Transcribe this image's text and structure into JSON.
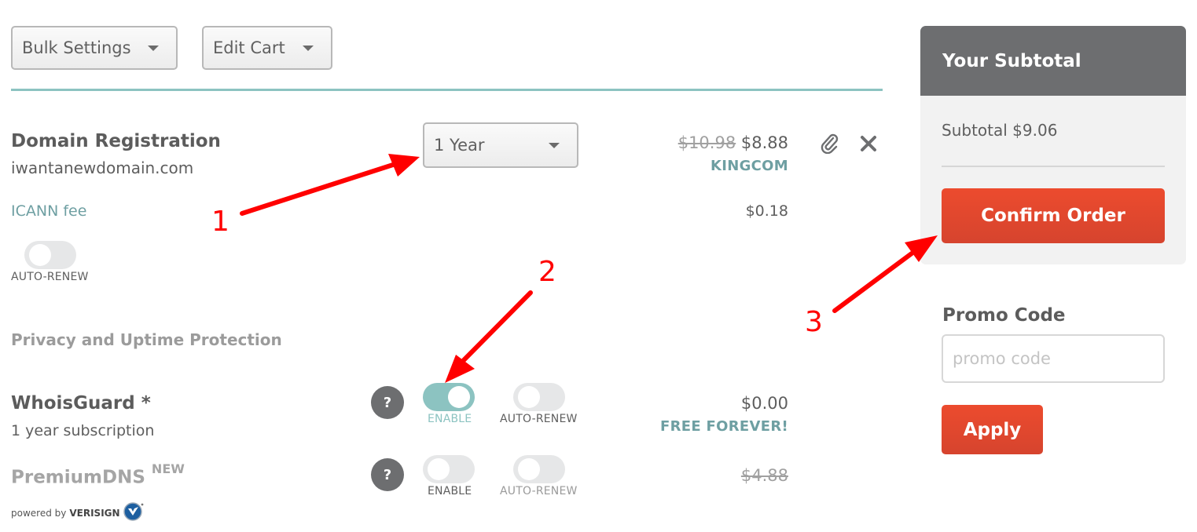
{
  "toolbar": {
    "bulk_settings": "Bulk Settings",
    "edit_cart": "Edit Cart"
  },
  "domain_registration": {
    "title": "Domain Registration",
    "domain": "iwantanewdomain.com",
    "period_selected": "1 Year",
    "original_price": "$10.98",
    "price": "$8.88",
    "promo_applied": "KINGCOM",
    "icann_fee_label": "ICANN fee",
    "icann_fee": "$0.18",
    "auto_renew_label": "AUTO-RENEW",
    "auto_renew_on": false,
    "attach_icon": "paperclip-icon",
    "remove_icon": "close-icon"
  },
  "privacy": {
    "section_title": "Privacy and Uptime Protection",
    "whoisguard": {
      "title": "WhoisGuard *",
      "subtitle": "1 year subscription",
      "help": "?",
      "enable_label": "ENABLE",
      "enable_on": true,
      "auto_renew_label": "AUTO-RENEW",
      "auto_renew_on": false,
      "price": "$0.00",
      "price_note": "FREE FOREVER!"
    },
    "premiumdns": {
      "title": "PremiumDNS",
      "badge": "NEW",
      "powered_by": "powered by",
      "brand": "VERISIGN",
      "help": "?",
      "enable_label": "ENABLE",
      "enable_on": false,
      "auto_renew_label": "AUTO-RENEW",
      "auto_renew_on": false,
      "price": "$4.88"
    }
  },
  "sidebar": {
    "header": "Your Subtotal",
    "subtotal": "Subtotal $9.06",
    "confirm_label": "Confirm Order",
    "promo_title": "Promo Code",
    "promo_placeholder": "promo code",
    "promo_value": "",
    "apply_label": "Apply"
  },
  "annotations": [
    "1",
    "2",
    "3"
  ],
  "colors": {
    "accent_teal": "#8cc3c1",
    "cta_red": "#e44b2f",
    "annotation_red": "#ff0000",
    "header_grey": "#6d6e70"
  }
}
